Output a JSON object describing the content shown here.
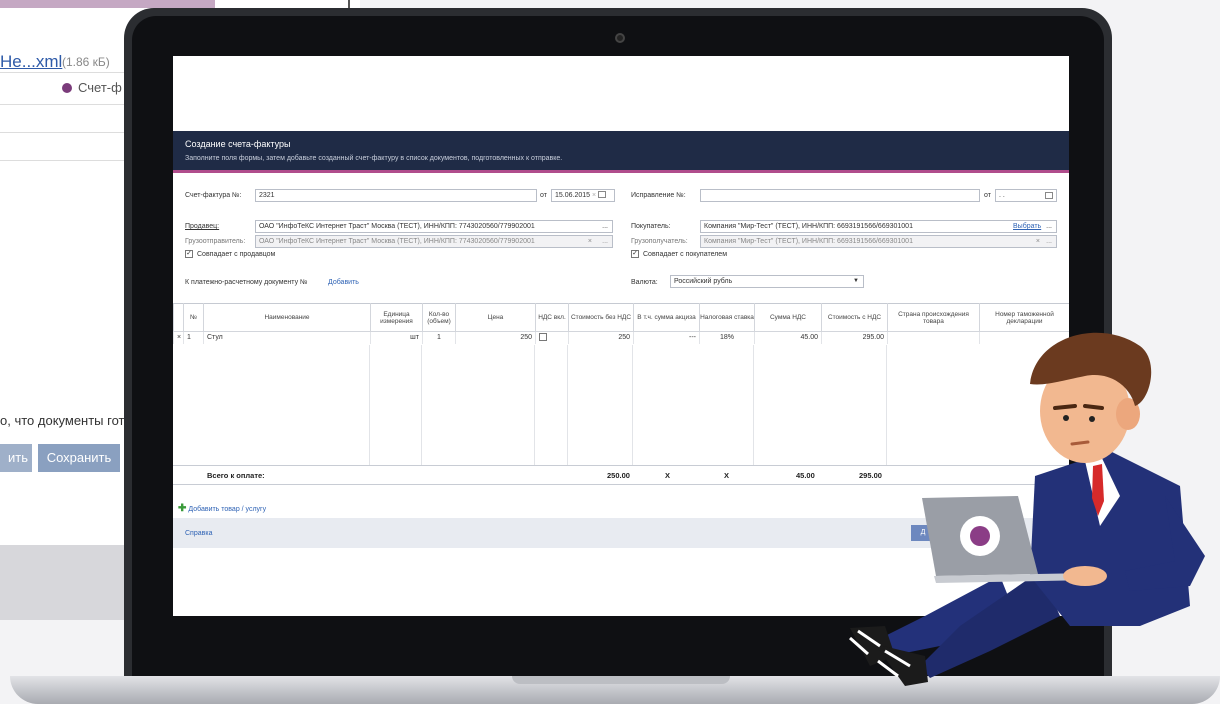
{
  "bg_window": {
    "file_link": "He...xml",
    "file_size": "(1.86 кБ)",
    "sf_label": "Счет-ф",
    "ready_text": "о, что документы готов",
    "btn_left": "ить",
    "btn_save": "Сохранить"
  },
  "form": {
    "title": "Создание счета-фактуры",
    "subtitle": "Заполните поля формы, затем добавьте созданный счет-фактуру в список документов, подготовленных к отправке.",
    "invoice_label": "Счет-фактура №:",
    "invoice_value": "2321",
    "date_label": "от",
    "date_value": "15.06.2015",
    "correction_label": "Исправление №:",
    "correction_value": "",
    "corr_date_label": "от",
    "corr_date_value": ". .",
    "seller_label": "Продавец:",
    "seller_value": "ОАО \"ИнфоТеКС Интернет Траст\" Москва (ТЕСТ), ИНН/КПП: 7743020560/779902001",
    "shipper_label": "Грузоотправитель:",
    "shipper_value": "ОАО \"ИнфоТеКС Интернет Траст\" Москва (ТЕСТ), ИНН/КПП: 7743020560/779902001",
    "same_seller": "Совпадает с продавцом",
    "buyer_label": "Покупатель:",
    "buyer_value": "Компания \"Мир-Тест\" (ТЕСТ), ИНН/КПП: 6693191566/669301001",
    "choose_link": "Выбрать",
    "consignee_label": "Грузополучатель:",
    "consignee_value": "Компания \"Мир-Тест\" (ТЕСТ), ИНН/КПП: 6693191566/669301001",
    "same_buyer": "Совпадает с покупателем",
    "payment_doc_label": "К платежно-расчетному документу №",
    "add_link": "Добавить",
    "currency_label": "Валюта:",
    "currency_value": "Российский рубль",
    "ellipsis": "...",
    "clear": "×"
  },
  "table": {
    "headers": [
      "",
      "№",
      "Наименование",
      "Единица измерения",
      "Кол-во (объем)",
      "Цена",
      "НДС вкл.",
      "Стоимость без НДС",
      "В т.ч. сумма акциза",
      "Налоговая ставка",
      "Сумма НДС",
      "Стоимость с НДС",
      "Страна происхождения товара",
      "Номер таможенной декларации"
    ],
    "row": {
      "del": "×",
      "num": "1",
      "name": "Стул",
      "unit": "шт",
      "qty": "1",
      "price": "250",
      "cost": "250",
      "excise": "---",
      "rate": "18%",
      "vat": "45.00",
      "total": "295.00"
    },
    "totals": {
      "label": "Всего к оплате:",
      "cost": "250.00",
      "excise": "X",
      "rate": "X",
      "vat": "45.00",
      "total": "295.00"
    }
  },
  "footer": {
    "add_item": "Добавить товар / услугу",
    "help": "Справка",
    "action": "Д"
  },
  "colors": {
    "banner": "#1f2b46",
    "accent": "#b04d8c",
    "link": "#2f63b5"
  }
}
